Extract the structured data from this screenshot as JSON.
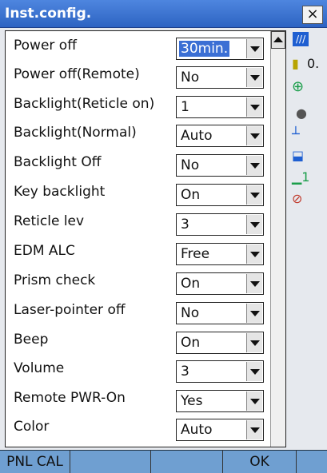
{
  "window": {
    "title": "Inst.config.",
    "close_label": "×"
  },
  "settings": [
    {
      "label": "Power off",
      "value": "30min.",
      "selected": true
    },
    {
      "label": "Power off(Remote)",
      "value": "No"
    },
    {
      "label": "Backlight(Reticle on)",
      "value": "1"
    },
    {
      "label": "Backlight(Normal)",
      "value": "Auto"
    },
    {
      "label": "Backlight Off",
      "value": "No"
    },
    {
      "label": "Key backlight",
      "value": "On"
    },
    {
      "label": "Reticle lev",
      "value": "3"
    },
    {
      "label": "EDM ALC",
      "value": "Free"
    },
    {
      "label": "Prism check",
      "value": "On"
    },
    {
      "label": "Laser-pointer off",
      "value": "No"
    },
    {
      "label": "Beep",
      "value": "On"
    },
    {
      "label": "Volume",
      "value": "3"
    },
    {
      "label": "Remote PWR-On",
      "value": "Yes"
    },
    {
      "label": "Color",
      "value": "Auto"
    }
  ],
  "sidebar": {
    "battery_text": "0."
  },
  "softkeys": {
    "k1": "PNL CAL",
    "k2": "",
    "k3": "",
    "k4": "OK",
    "k5": ""
  }
}
